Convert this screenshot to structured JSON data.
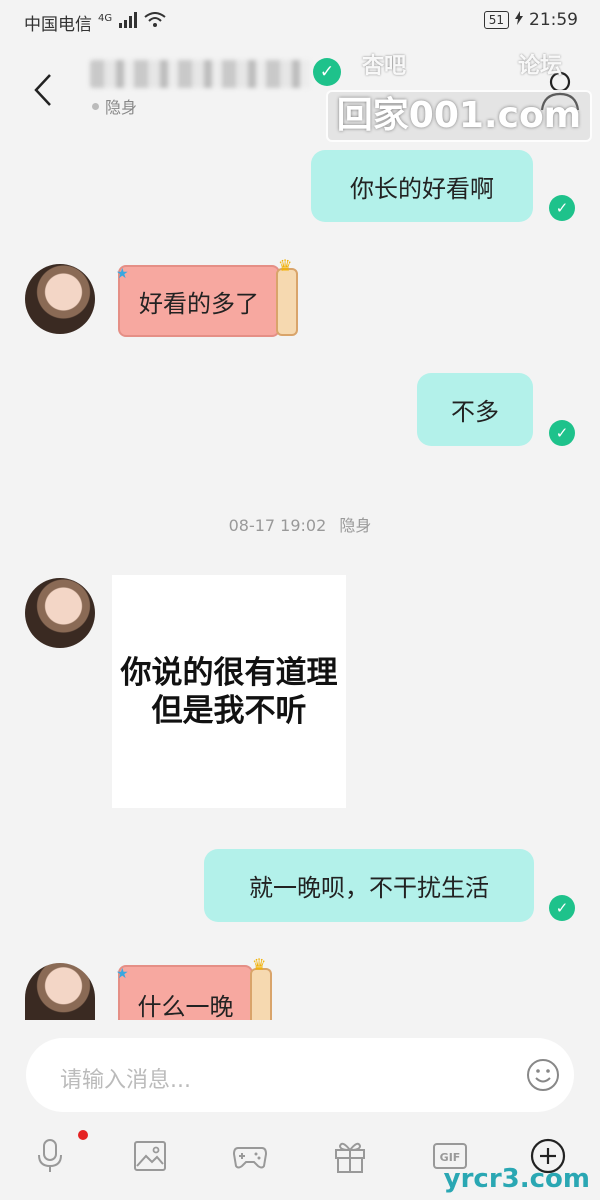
{
  "status_bar": {
    "carrier": "中国电信",
    "network": "4G",
    "battery": "51",
    "time": "21:59"
  },
  "header": {
    "presence": "隐身",
    "icons": {
      "back": "back-chevron-icon",
      "verified": "check-badge-icon",
      "profile": "person-icon"
    }
  },
  "watermark": {
    "left": "杏吧",
    "right": "论坛",
    "main": "回家001.com"
  },
  "messages": [
    {
      "direction": "out",
      "text": "你长的好看啊"
    },
    {
      "direction": "in",
      "text": "好看的多了"
    },
    {
      "direction": "out",
      "text": "不多"
    },
    {
      "direction": "in",
      "type": "sticker",
      "lines": [
        "你说的很有道理",
        "但是我不听"
      ]
    },
    {
      "direction": "out",
      "text": "就一晚呗，不干扰生活"
    },
    {
      "direction": "in",
      "text": "什么一晚"
    }
  ],
  "timestamp": {
    "time": "08-17 19:02",
    "status": "隐身"
  },
  "input": {
    "placeholder": "请输入消息..."
  },
  "toolbar": {
    "items": [
      "microphone-icon",
      "image-icon",
      "gamepad-icon",
      "gift-icon",
      "gif-icon",
      "plus-circle-icon"
    ],
    "gif_label": "GIF"
  },
  "site_mark": "yrcr3.com",
  "colors": {
    "outgoing_bubble": "#b3f1ea",
    "incoming_bubble": "#f7a8a0",
    "read_check": "#1ec28b",
    "background": "#f3f3f3"
  }
}
